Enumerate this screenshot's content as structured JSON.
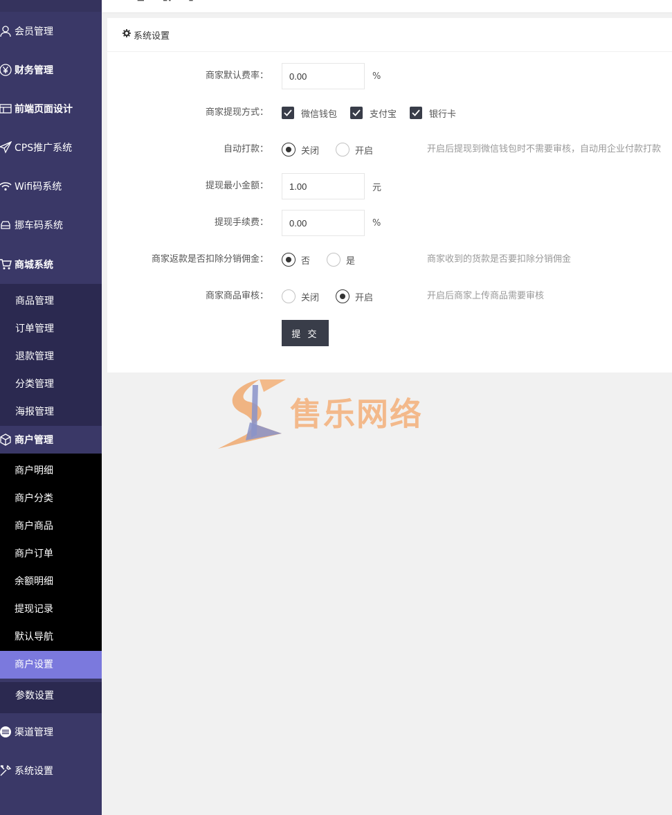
{
  "sidebar": {
    "groups": [
      {
        "label": "会员管理",
        "icon": "user-icon"
      },
      {
        "label": "财务管理",
        "icon": "yen-icon"
      },
      {
        "label": "前端页面设计",
        "icon": "layout-icon"
      },
      {
        "label": "CPS推广系统",
        "icon": "paper-plane-icon"
      },
      {
        "label": "Wifi码系统",
        "icon": "wifi-icon"
      },
      {
        "label": "挪车码系统",
        "icon": "car-icon"
      },
      {
        "label": "商城系统",
        "icon": "cart-icon"
      },
      {
        "label": "商户管理",
        "icon": "cube-icon"
      },
      {
        "label": "渠道管理",
        "icon": "list-circle-icon"
      },
      {
        "label": "系统设置",
        "icon": "tools-icon"
      }
    ],
    "mall_sub": [
      "商品管理",
      "订单管理",
      "退款管理",
      "分类管理",
      "海报管理"
    ],
    "merchant_sub": [
      "商户明细",
      "商户分类",
      "商户商品",
      "商户订单",
      "余额明细",
      "提现记录",
      "默认导航",
      "商户设置"
    ],
    "extra_sub": [
      "参数设置"
    ],
    "active_item": "商户设置",
    "colors": {
      "bg": "#3a3867",
      "sub_bg": "#2b2950",
      "active": "#7b79dd"
    }
  },
  "card": {
    "title": "系统设置",
    "fields": {
      "rate": {
        "label": "商家默认费率：",
        "value": "0.00",
        "unit": "%"
      },
      "withdraw_methods": {
        "label": "商家提现方式：",
        "options": [
          "微信钱包",
          "支付宝",
          "银行卡"
        ],
        "checked": [
          true,
          true,
          true
        ]
      },
      "auto_pay": {
        "label": "自动打款：",
        "options": [
          "关闭",
          "开启"
        ],
        "selected": "关闭",
        "hint": "开启后提现到微信钱包时不需要审核，自动用企业付款打款"
      },
      "min_amount": {
        "label": "提现最小金额：",
        "value": "1.00",
        "unit": "元"
      },
      "fee": {
        "label": "提现手续费：",
        "value": "0.00",
        "unit": "%"
      },
      "deduct_commission": {
        "label": "商家返款是否扣除分销佣金：",
        "options": [
          "否",
          "是"
        ],
        "selected": "否",
        "hint": "商家收到的货款是否要扣除分销佣金"
      },
      "goods_review": {
        "label": "商家商品审核：",
        "options": [
          "关闭",
          "开启"
        ],
        "selected": "开启",
        "hint": "开启后商家上传商品需要审核"
      }
    },
    "submit_label": "提 交"
  },
  "watermark": {
    "text": "售乐网络"
  }
}
